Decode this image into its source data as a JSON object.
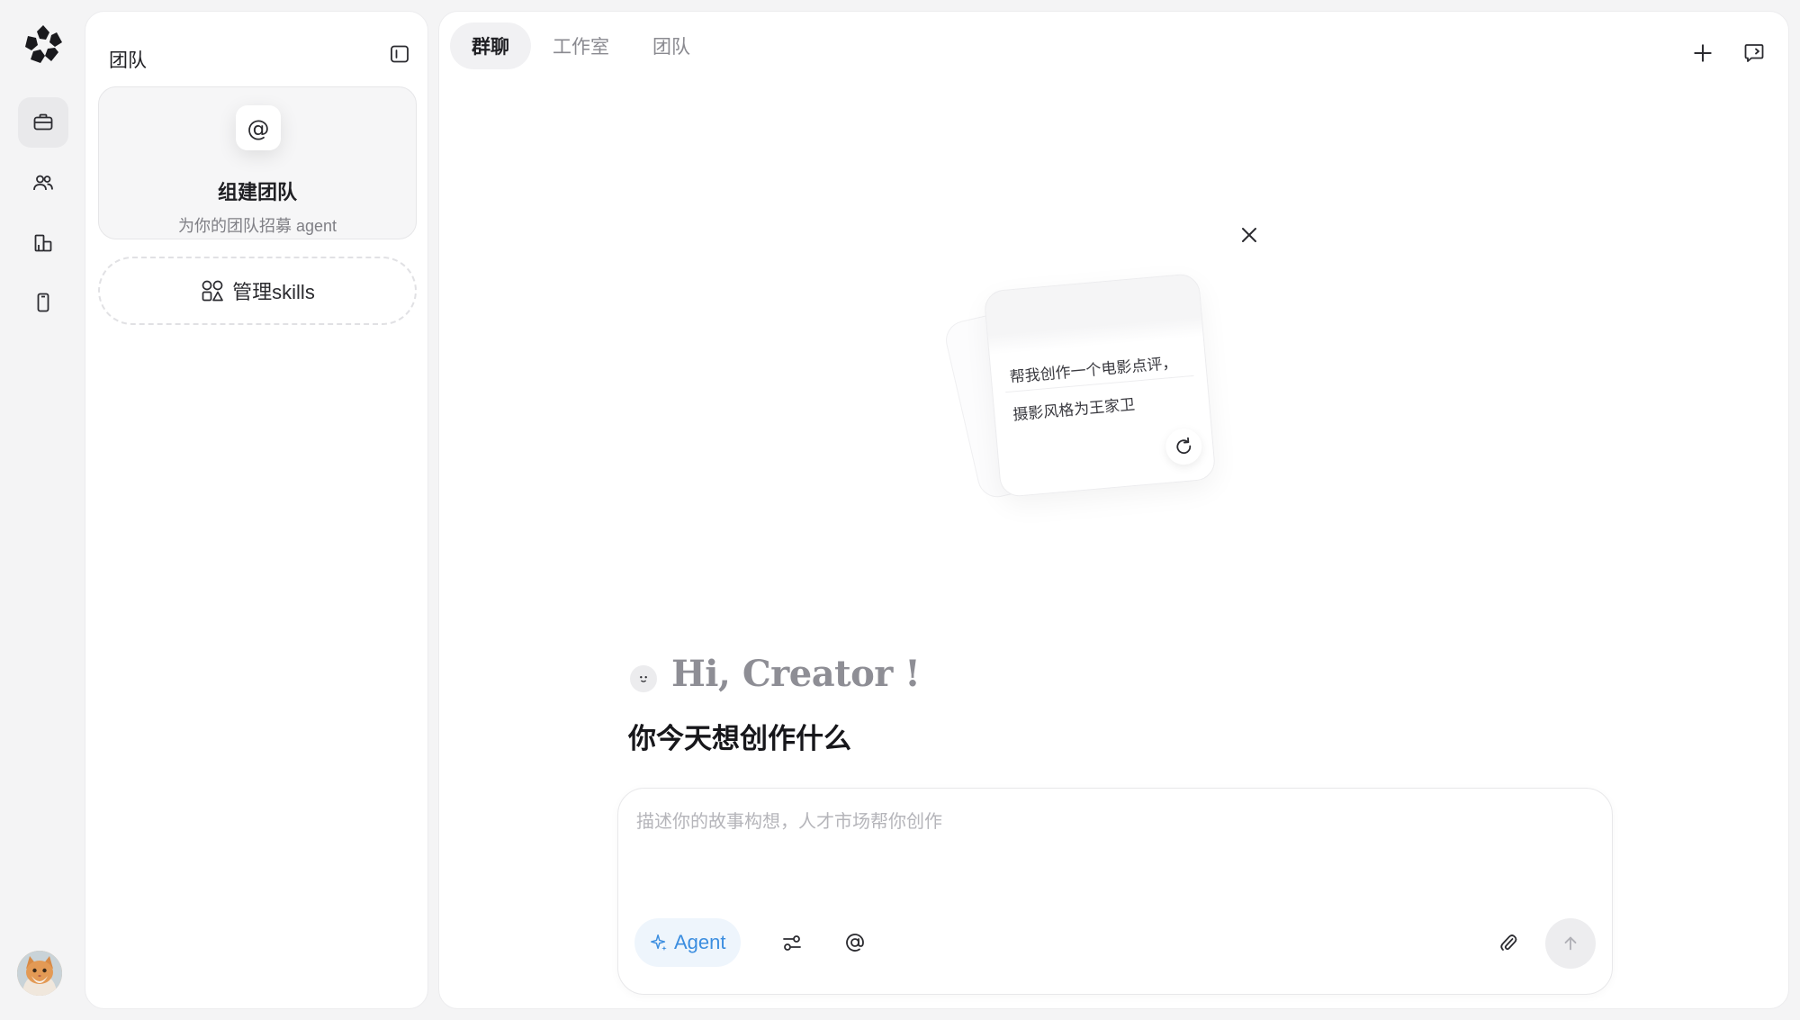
{
  "rail": {
    "items": [
      {
        "icon": "briefcase-icon",
        "active": true
      },
      {
        "icon": "people-icon",
        "active": false
      },
      {
        "icon": "buildings-icon",
        "active": false
      },
      {
        "icon": "phone-icon",
        "active": false
      }
    ]
  },
  "team_panel": {
    "title": "团队",
    "build_card": {
      "icon_glyph": "@",
      "title": "组建团队",
      "subtitle": "为你的团队招募 agent"
    },
    "skills_button": {
      "label": "管理skills"
    }
  },
  "main": {
    "tabs": [
      {
        "label": "群聊",
        "active": true
      },
      {
        "label": "工作室",
        "active": false
      },
      {
        "label": "团队",
        "active": false
      }
    ],
    "tip_card": {
      "line1": "帮我创作一个电影点评，",
      "line2": "摄影风格为王家卫"
    },
    "greeting": {
      "hi": "Hi, Creator !",
      "subtitle": "你今天想创作什么"
    },
    "composer": {
      "placeholder": "描述你的故事构想，人才市场帮你创作",
      "value": "",
      "agent_label": "Agent"
    }
  },
  "colors": {
    "accent_blue": "#3c8ee0",
    "agent_bg": "#eef5fc",
    "background": "#f4f4f5",
    "panel": "#ffffff"
  }
}
